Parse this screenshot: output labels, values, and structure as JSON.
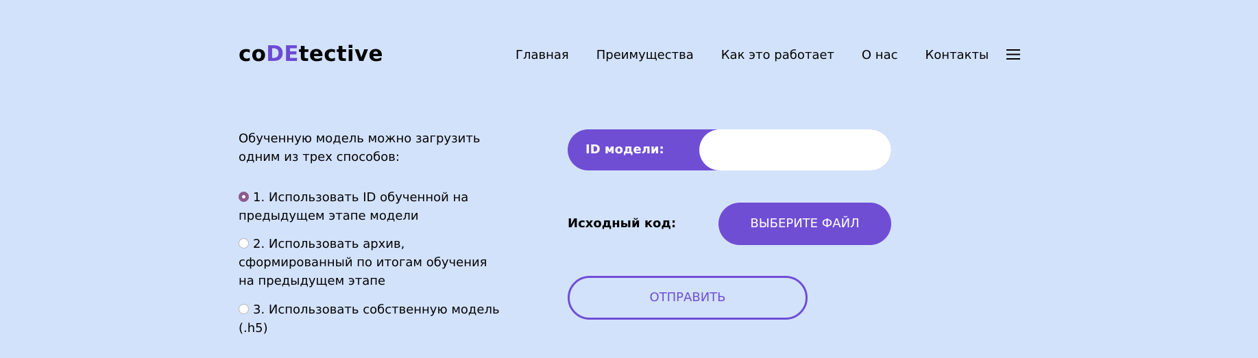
{
  "header": {
    "logo": {
      "part1": "co",
      "part2": "DE",
      "part3": "tective"
    },
    "nav": [
      "Главная",
      "Преимущества",
      "Как это работает",
      "О нас",
      "Контакты"
    ],
    "menu_icon": "hamburger-menu-icon"
  },
  "main": {
    "intro": "Обученную модель можно загрузить одним из трех способов:",
    "options": [
      {
        "label": "1. Использовать ID обученной на предыдущем этапе модели",
        "checked": true
      },
      {
        "label": "2. Использовать архив, сформированный по итогам обучения на предыдущем этапе",
        "checked": false
      },
      {
        "label": "3. Использовать собственную модель (.h5)",
        "checked": false
      }
    ],
    "id_label": "ID модели:",
    "id_value": "",
    "source_label": "Исходный код:",
    "file_button": "ВЫБЕРИТЕ ФАЙЛ",
    "submit_button": "ОТПРАВИТЬ"
  },
  "colors": {
    "background": "#d3e2fb",
    "accent": "#6f4ed4",
    "radio_checked": "#8c5a8f"
  }
}
